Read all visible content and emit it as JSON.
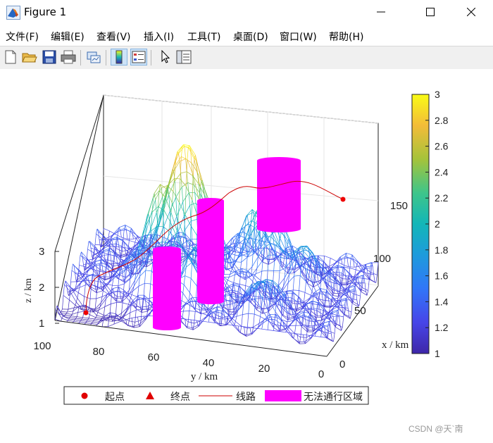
{
  "window": {
    "title": "Figure 1",
    "minimize_glyph": "—",
    "maximize_glyph": "☐",
    "close_glyph": "✕"
  },
  "menu": [
    {
      "label": "文件(F)"
    },
    {
      "label": "编辑(E)"
    },
    {
      "label": "查看(V)"
    },
    {
      "label": "插入(I)"
    },
    {
      "label": "工具(T)"
    },
    {
      "label": "桌面(D)"
    },
    {
      "label": "窗口(W)"
    },
    {
      "label": "帮助(H)"
    }
  ],
  "toolbar": [
    {
      "icon": "new-figure-icon"
    },
    {
      "icon": "open-file-icon"
    },
    {
      "icon": "save-icon"
    },
    {
      "icon": "print-icon"
    },
    {
      "icon": "link-plot-icon"
    },
    {
      "icon": "insert-colorbar-icon",
      "selected": true
    },
    {
      "icon": "insert-legend-icon",
      "selected": true
    },
    {
      "icon": "pointer-icon"
    },
    {
      "icon": "property-inspector-icon"
    }
  ],
  "plot": {
    "xlabel": "x / km",
    "ylabel": "y / km",
    "zlabel": "z / km",
    "x_ticks": [
      "0",
      "50",
      "100",
      "150"
    ],
    "y_ticks": [
      "100",
      "80",
      "60",
      "40",
      "20",
      "0"
    ],
    "z_ticks": [
      "1",
      "2",
      "3"
    ],
    "colorbar_ticks": [
      "1",
      "1.2",
      "1.4",
      "1.6",
      "1.8",
      "2",
      "2.2",
      "2.4",
      "2.6",
      "2.8",
      "3"
    ],
    "colormap": "parula",
    "colorbar_range": [
      1,
      3
    ],
    "no_go_color": "#ff00ff",
    "path_color": "#cc0000",
    "start_color": "#ee0000",
    "end_color": "#ee0000"
  },
  "legend": {
    "start": "起点",
    "end": "终点",
    "route": "线路",
    "zone": "无法通行区域"
  },
  "watermark": "CSDN @天`南"
}
